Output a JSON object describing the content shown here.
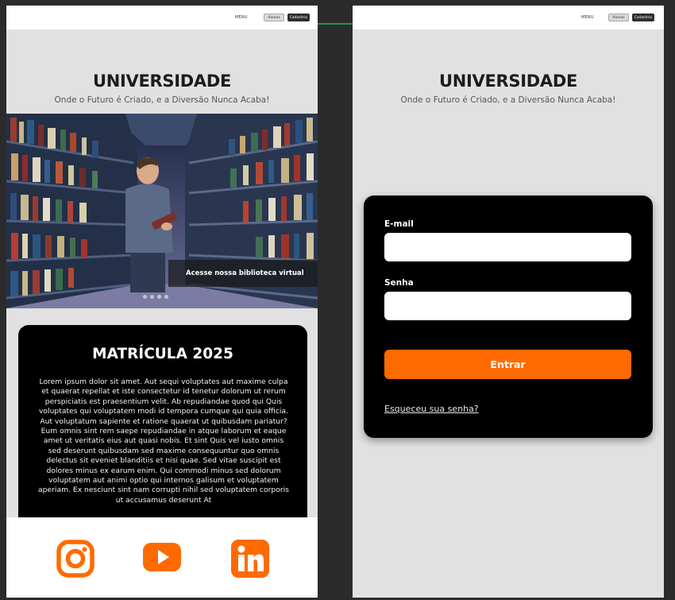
{
  "nav": {
    "menu": "MENU",
    "alunos": "Alunos",
    "cadastro": "Cadastros"
  },
  "brand": {
    "title": "UNIVERSIDADE",
    "tagline": "Onde o Futuro é Criado, e a Diversão Nunca Acaba!"
  },
  "home": {
    "hero_caption": "Acesse nossa biblioteca virtual",
    "carousel_dots": 4,
    "enroll_title": "MATRÍCULA 2025",
    "enroll_text": "Lorem ipsum dolor sit amet. Aut sequi voluptates aut maxime culpa et quaerat repellat et iste consectetur id tenetur dolorum ut rerum perspiciatis est praesentium velit. Ab repudiandae quod qui Quis voluptates qui voluptatem modi id tempora cumque qui quia officia. Aut voluptatum sapiente et ratione quaerat ut quibusdam pariatur? Eum omnis sint rem saepe repudiandae in atque laborum et eaque amet ut veritatis eius aut quasi nobis. Et sint Quis vel iusto omnis sed deserunt quibusdam sed maxime consequuntur quo omnis delectus sit eveniet blanditiis et nisi quae. Sed vitae suscipit est dolores minus ex earum enim. Qui commodi minus sed dolorum voluptatem aut animi optio qui internos galisum et voluptatem aperiam. Ex nesciunt sint nam corrupti nihil sed voluptatem corporis ut accusamus deserunt At"
  },
  "social": [
    "instagram-icon",
    "youtube-icon",
    "linkedin-icon"
  ],
  "login": {
    "email_label": "E-mail",
    "email_value": "",
    "password_label": "Senha",
    "password_value": "",
    "submit": "Entrar",
    "forgot": "Esqueceu sua senha?"
  },
  "colors": {
    "accent": "#ff6a00",
    "arrow": "#1f9a2e",
    "card": "#000000",
    "page": "#e1e1e1"
  }
}
